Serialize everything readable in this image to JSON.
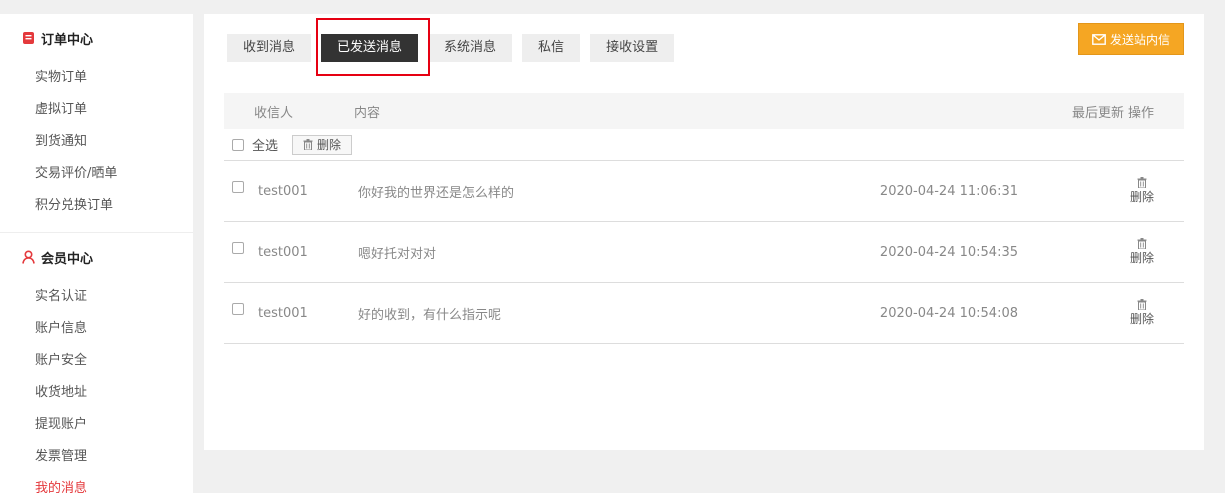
{
  "sidebar": {
    "sections": [
      {
        "title": "订单中心",
        "icon": "order-icon",
        "items": [
          "实物订单",
          "虚拟订单",
          "到货通知",
          "交易评价/晒单",
          "积分兑换订单"
        ]
      },
      {
        "title": "会员中心",
        "icon": "user-icon",
        "items": [
          "实名认证",
          "账户信息",
          "账户安全",
          "收货地址",
          "提现账户",
          "发票管理",
          "我的消息"
        ]
      }
    ],
    "active_item": "我的消息"
  },
  "tabs": [
    "收到消息",
    "已发送消息",
    "系统消息",
    "私信",
    "接收设置"
  ],
  "active_tab": "已发送消息",
  "send_button": "发送站内信",
  "table": {
    "headers": {
      "receiver": "收信人",
      "content": "内容",
      "updated": "最后更新",
      "action": "操作"
    },
    "select_all": "全选",
    "delete": "删除",
    "rows": [
      {
        "receiver": "test001",
        "content": "你好我的世界还是怎么样的",
        "time": "2020-04-24 11:06:31",
        "action": "删除"
      },
      {
        "receiver": "test001",
        "content": "嗯好托对对对",
        "time": "2020-04-24 10:54:35",
        "action": "删除"
      },
      {
        "receiver": "test001",
        "content": "好的收到，有什么指示呢",
        "time": "2020-04-24 10:54:08",
        "action": "删除"
      }
    ]
  },
  "colors": {
    "accent_red": "#e4393c",
    "send_orange": "#f5a623",
    "tab_active": "#333333",
    "highlight": "#e60012"
  }
}
